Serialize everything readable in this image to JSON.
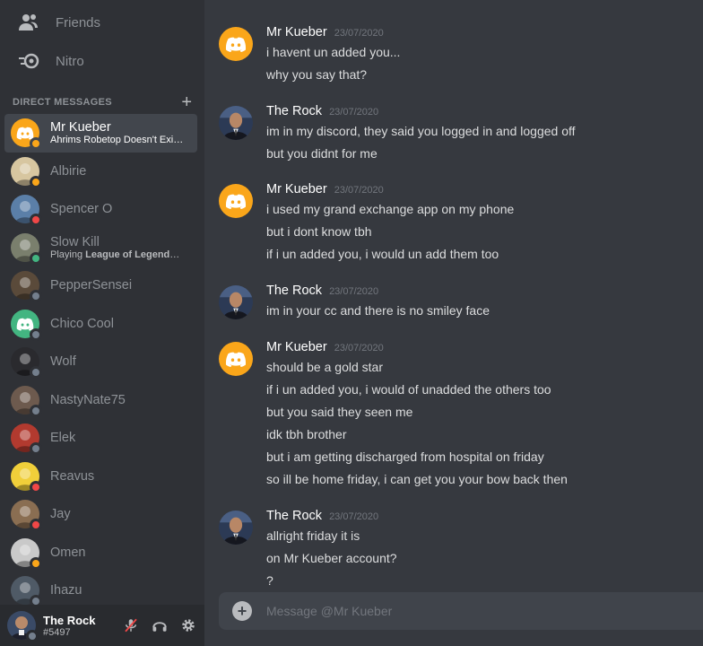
{
  "sidebar": {
    "nav": [
      {
        "label": "Friends",
        "icon": "friends-icon"
      },
      {
        "label": "Nitro",
        "icon": "nitro-icon"
      }
    ],
    "dm_header": "DIRECT MESSAGES",
    "dms": [
      {
        "name": "Mr Kueber",
        "sub": "Ahrims Robetop Doesn't Exis...",
        "status": "idle",
        "avatar": "discord",
        "color": "#faa61a",
        "active": true
      },
      {
        "name": "Albirie",
        "sub": "",
        "status": "idle",
        "avatar": "person",
        "color": "#d7c6a0"
      },
      {
        "name": "Spencer O",
        "sub": "",
        "status": "dnd",
        "avatar": "person",
        "color": "#5b7fa8"
      },
      {
        "name": "Slow Kill",
        "sub_prefix": "Playing ",
        "sub_game": "League of Legends",
        "status": "online",
        "avatar": "person",
        "color": "#7a7f6d"
      },
      {
        "name": "PepperSensei",
        "sub": "",
        "status": "offline",
        "avatar": "person",
        "color": "#5a4a3a"
      },
      {
        "name": "Chico Cool",
        "sub": "",
        "status": "offline",
        "avatar": "discord",
        "color": "#43b581"
      },
      {
        "name": "Wolf",
        "sub": "",
        "status": "offline",
        "avatar": "person",
        "color": "#2a2a2e"
      },
      {
        "name": "NastyNate75",
        "sub": "",
        "status": "offline",
        "avatar": "person",
        "color": "#6d5a4e"
      },
      {
        "name": "Elek",
        "sub": "",
        "status": "offline",
        "avatar": "person",
        "color": "#b23a2f"
      },
      {
        "name": "Reavus",
        "sub": "",
        "status": "dnd",
        "avatar": "person",
        "color": "#f0cf3a"
      },
      {
        "name": "Jay",
        "sub": "",
        "status": "dnd",
        "avatar": "person",
        "color": "#8a6e52"
      },
      {
        "name": "Omen",
        "sub": "",
        "status": "idle",
        "avatar": "person",
        "color": "#c9c9c9"
      },
      {
        "name": "Ihazu",
        "sub": "",
        "status": "offline",
        "avatar": "person",
        "color": "#4f5a66"
      }
    ]
  },
  "user": {
    "name": "The Rock",
    "tag": "#5497",
    "status": "offline"
  },
  "chat": {
    "messages": [
      {
        "author": "Mr Kueber",
        "time": "23/07/2020",
        "avatar": "discord",
        "lines": [
          "i havent un added you...",
          "why you say that?"
        ]
      },
      {
        "author": "The Rock",
        "time": "23/07/2020",
        "avatar": "rock",
        "lines": [
          "im in my discord, they said you logged in and logged off",
          "but you didnt for me"
        ]
      },
      {
        "author": "Mr Kueber",
        "time": "23/07/2020",
        "avatar": "discord",
        "lines": [
          "i used my grand exchange app on my phone",
          "but i dont know tbh",
          "if i un added you, i would un add them too"
        ]
      },
      {
        "author": "The Rock",
        "time": "23/07/2020",
        "avatar": "rock",
        "lines": [
          "im in your cc and there is no smiley face"
        ]
      },
      {
        "author": "Mr Kueber",
        "time": "23/07/2020",
        "avatar": "discord",
        "lines": [
          "should be a gold star",
          "if i un added you, i would of unadded the others too",
          "but you said they seen me",
          "idk tbh brother",
          "but i am getting discharged from hospital on friday",
          "so ill be home friday, i can get you your bow back then"
        ]
      },
      {
        "author": "The Rock",
        "time": "23/07/2020",
        "avatar": "rock",
        "lines": [
          "allright friday it is",
          "on Mr Kueber account?",
          "?"
        ]
      }
    ],
    "composer_placeholder": "Message @Mr Kueber"
  },
  "colors": {
    "accent": "#faa61a",
    "background": "#36393f",
    "sidebar": "#2f3136"
  }
}
